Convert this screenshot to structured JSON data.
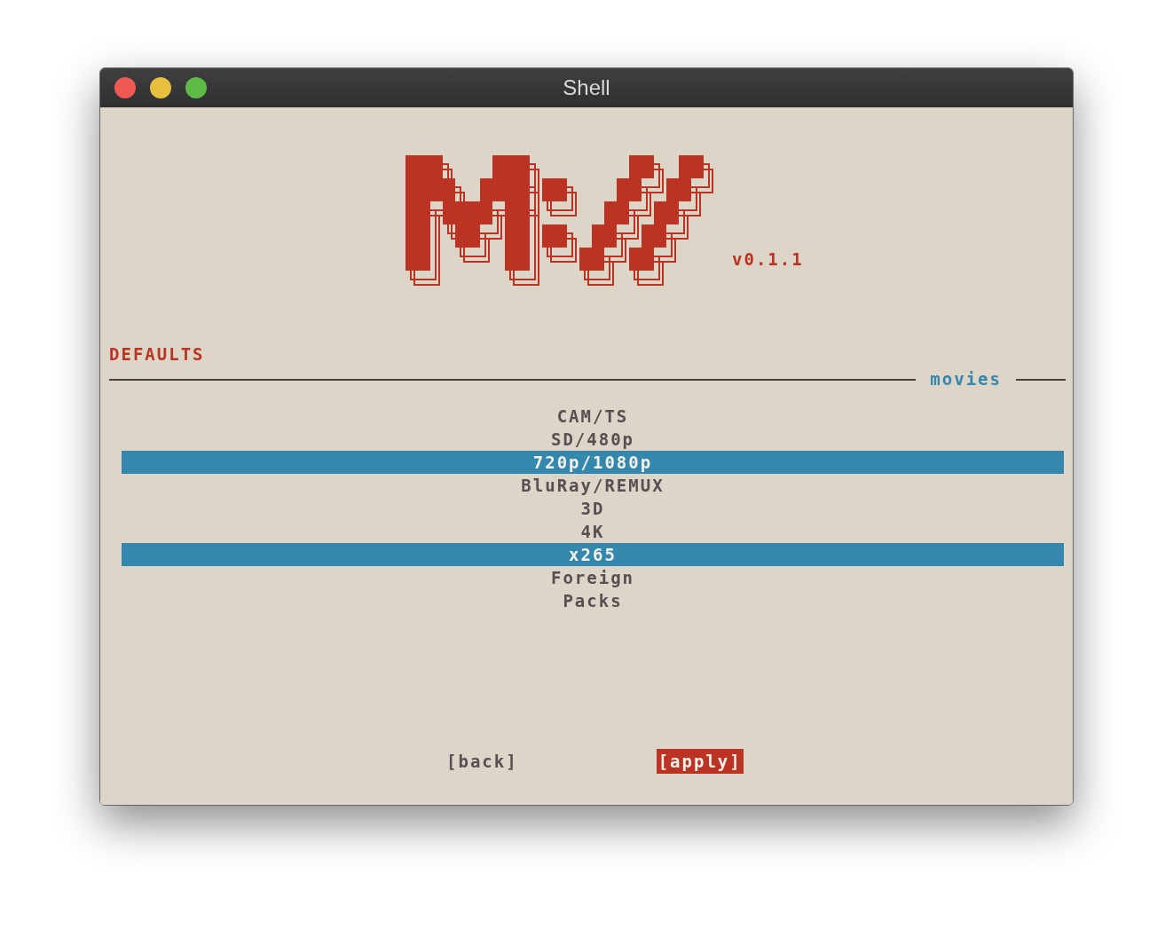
{
  "window": {
    "title": "Shell"
  },
  "logo": {
    "version": "v0.1.1"
  },
  "section": {
    "title": "DEFAULTS",
    "group": "movies"
  },
  "options": [
    {
      "label": "CAM/TS",
      "selected": false
    },
    {
      "label": "SD/480p",
      "selected": false
    },
    {
      "label": "720p/1080p",
      "selected": true
    },
    {
      "label": "BluRay/REMUX",
      "selected": false
    },
    {
      "label": "3D",
      "selected": false
    },
    {
      "label": "4K",
      "selected": false
    },
    {
      "label": "x265",
      "selected": true
    },
    {
      "label": "Foreign",
      "selected": false
    },
    {
      "label": "Packs",
      "selected": false
    }
  ],
  "buttons": [
    {
      "label": "[back]",
      "selected": false
    },
    {
      "label": "[apply]",
      "selected": true
    }
  ]
}
